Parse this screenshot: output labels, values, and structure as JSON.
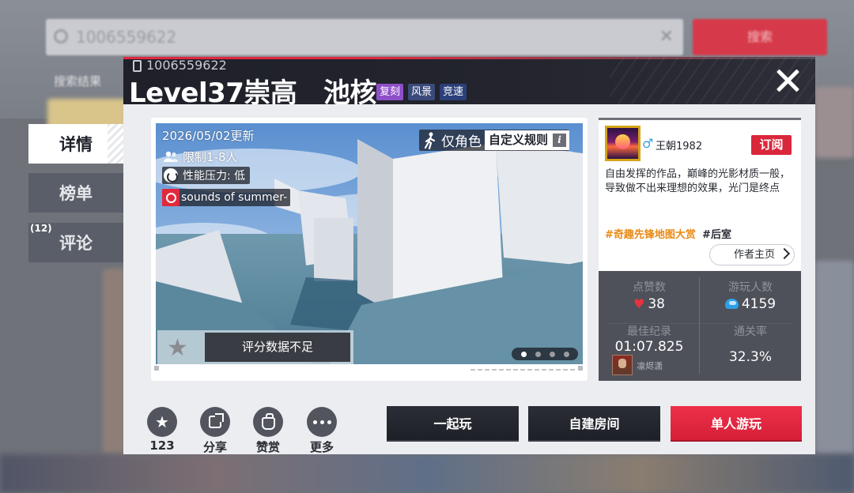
{
  "background": {
    "search_value": "1006559622",
    "search_button": "搜索",
    "result_label": "搜索结果"
  },
  "side_tabs": {
    "detail": "详情",
    "rank": "榜单",
    "comment": "评论",
    "comment_count": "(12)"
  },
  "map": {
    "id": "1006559622",
    "title": "Level37崇高　池核",
    "tags": [
      "复刻",
      "风景",
      "竞速"
    ]
  },
  "preview": {
    "updated": "2026/05/02更新",
    "player_limit": "限制1-8人",
    "performance": "性能压力: 低",
    "music": "sounds of summer-",
    "role_mode": "仅角色",
    "custom_rules": "自定义规则",
    "info_glyph": "i",
    "rating_text": "评分数据不足",
    "slide_count": 4,
    "active_slide": 0
  },
  "author": {
    "name": "王朝1982",
    "subscribe": "订阅",
    "description": "自由发挥的作品，巅峰的光影材质一般，导致做不出来理想的效果，光门是终点",
    "hashtag_event": "#奇趣先锋地图大赏",
    "hashtag_other": "#后室",
    "home_button": "作者主页"
  },
  "stats": {
    "likes_label": "点赞数",
    "likes_value": "38",
    "players_label": "游玩人数",
    "players_value": "4159",
    "best_label": "最佳纪录",
    "best_value": "01:07.825",
    "best_player": "凛烬潇",
    "clear_label": "通关率",
    "clear_value": "32.3%"
  },
  "actions": {
    "favorite_count": "123",
    "share": "分享",
    "reward": "赞赏",
    "more": "更多"
  },
  "buttons": {
    "play_together": "一起玩",
    "create_room": "自建房间",
    "solo_play": "单人游玩"
  },
  "colors": {
    "accent_red": "#d9273c",
    "header_dark": "#1f2029",
    "stats_panel": "#4e5159",
    "hashtag_orange": "#e88a16"
  }
}
